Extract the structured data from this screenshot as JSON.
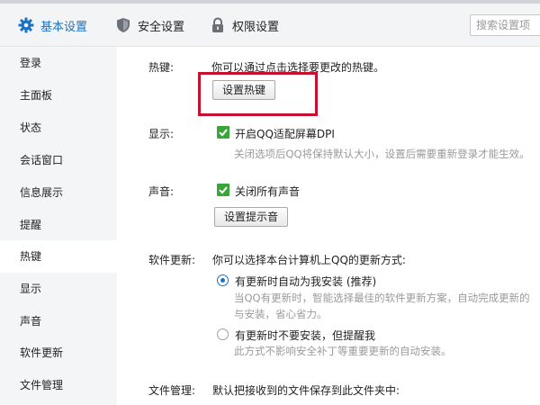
{
  "tabs": [
    {
      "label": "基本设置",
      "icon": "gear-icon",
      "active": true
    },
    {
      "label": "安全设置",
      "icon": "shield-icon",
      "active": false
    },
    {
      "label": "权限设置",
      "icon": "lock-icon",
      "active": false
    }
  ],
  "search": {
    "placeholder": "搜索设置项"
  },
  "sidebar": {
    "items": [
      "登录",
      "主面板",
      "状态",
      "会话窗口",
      "信息展示",
      "提醒",
      "热键",
      "显示",
      "声音",
      "软件更新",
      "文件管理"
    ],
    "active_index": 6
  },
  "hotkey": {
    "label": "热键:",
    "desc": "你可以通过点击选择要更改的热键。",
    "button": "设置热键"
  },
  "display": {
    "label": "显示:",
    "check_label": "开启QQ适配屏幕DPI",
    "checked": true,
    "hint": "关闭选项后QQ将保持默认大小，设置后需要重新登录才能生效。"
  },
  "sound": {
    "label": "声音:",
    "check_label": "关闭所有声音",
    "checked": true,
    "button": "设置提示音"
  },
  "update": {
    "label": "软件更新:",
    "desc": "你可以选择本台计算机上QQ的更新方式:",
    "option1": "有更新时自动为我安装 (推荐)",
    "option1_hint1": "当QQ有更新时，智能选择最佳的软件更新方案，自动完成更新的",
    "option1_hint2": "与安装，省心省力。",
    "option2": "有更新时不要安装，但提醒我",
    "option2_hint": "此方式不影响安全补丁等重要更新的自动安装。",
    "selected": 1
  },
  "files": {
    "label": "文件管理:",
    "desc": "默认把接收到的文件保存到此文件夹中:"
  },
  "colors": {
    "accent": "#1a73c4",
    "check_green": "#3aa63a",
    "highlight_red": "#c8102e"
  }
}
